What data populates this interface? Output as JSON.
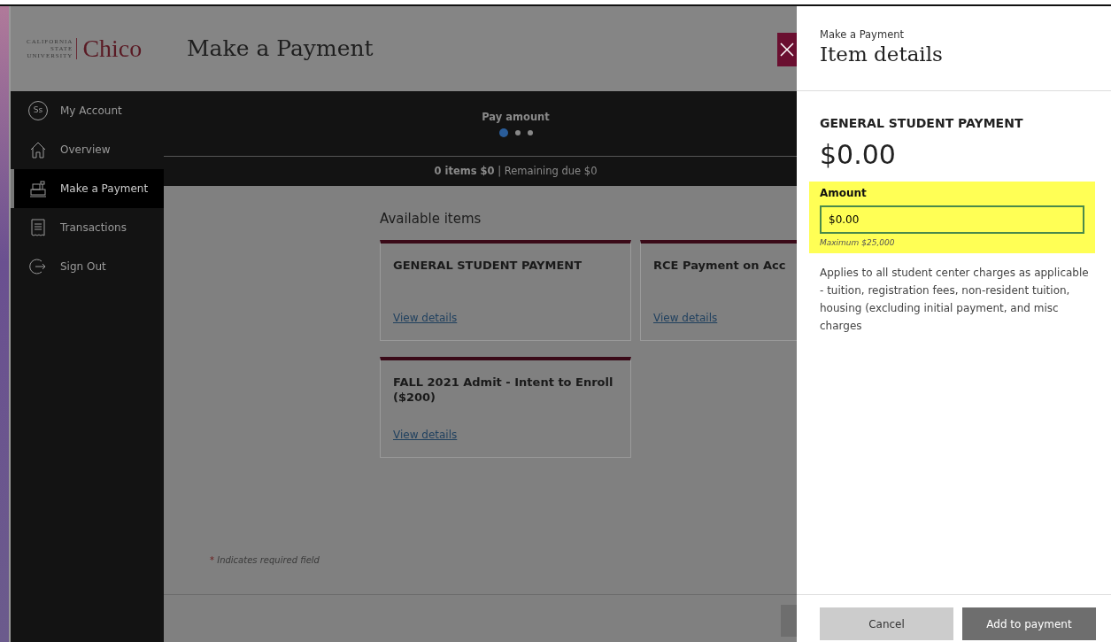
{
  "logo": {
    "small_lines": [
      "CALIFORNIA",
      "STATE",
      "UNIVERSITY"
    ],
    "name": "Chico"
  },
  "page_title": "Make a Payment",
  "sidebar": {
    "items": [
      {
        "label": "My Account",
        "avatar": "Ss",
        "selected": false
      },
      {
        "label": "Overview",
        "selected": false
      },
      {
        "label": "Make a Payment",
        "selected": true
      },
      {
        "label": "Transactions",
        "selected": false
      },
      {
        "label": "Sign Out",
        "selected": false
      }
    ]
  },
  "progress": {
    "label": "Pay amount",
    "steps": [
      {
        "selected": true
      },
      {
        "selected": false
      },
      {
        "selected": false
      }
    ]
  },
  "summary": "**0 items $0** | Remaining due $0",
  "available_items": {
    "heading": "Available items",
    "cards": [
      {
        "title": "GENERAL STUDENT PAYMENT",
        "link": "View details"
      },
      {
        "title": "RCE Payment on Acc",
        "link": "View details"
      },
      {
        "title": "FALL 2021 Admit - Intent to Enroll ($200)",
        "link": "View details"
      }
    ]
  },
  "required_note": {
    "mark": "*",
    "text": "Indicates required field"
  },
  "details_panel": {
    "breadcrumb": "Make a Payment",
    "title": "Item details",
    "item_name": "GENERAL STUDENT PAYMENT",
    "price": "$0.00",
    "amount": {
      "label": "Amount",
      "value": "$0.00",
      "hint": "Maximum $25,000",
      "highlighted": true
    },
    "description": "Applies to all student center charges as applicable - tuition, registration fees, non-resident tuition, housing (excluding initial payment, and misc charges",
    "buttons": [
      {
        "label": "Cancel",
        "kind": "secondary"
      },
      {
        "label": "Add to payment",
        "kind": "primary"
      }
    ]
  }
}
